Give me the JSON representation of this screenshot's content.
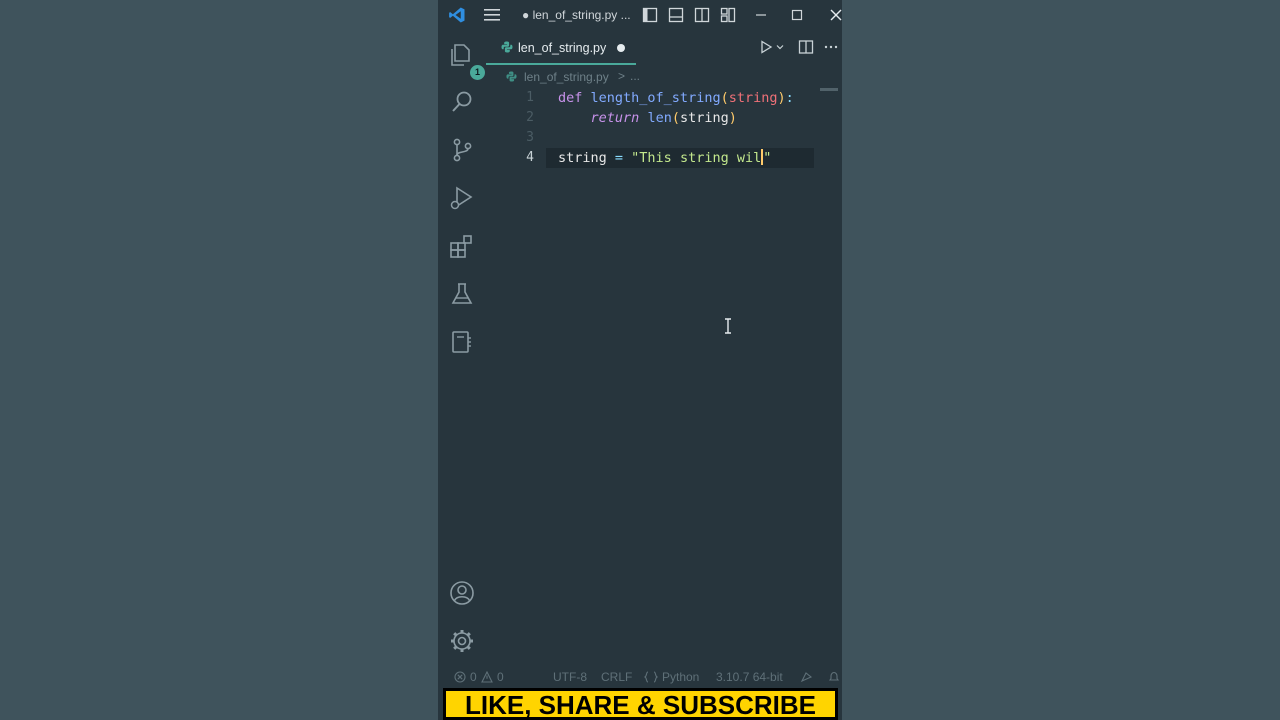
{
  "titlebar": {
    "title": "● len_of_string.py ..."
  },
  "activity": {
    "explorer_badge": "1"
  },
  "tab": {
    "label": "len_of_string.py"
  },
  "breadcrumb": {
    "file": "len_of_string.py",
    "separator": ">",
    "more": "..."
  },
  "editor": {
    "line_numbers": [
      "1",
      "2",
      "3",
      "4"
    ],
    "lines": [
      {
        "def": "def",
        "name": "length_of_string",
        "open": "(",
        "param": "string",
        "close": ")",
        "colon": ":"
      },
      {
        "indent": "    ",
        "ret": "return",
        "builtin": "len",
        "open": "(",
        "arg": "string",
        "close": ")"
      },
      {},
      {
        "var": "string",
        "assign": " = ",
        "text": "\"This string wil",
        "quote": "\""
      }
    ]
  },
  "statusbar": {
    "errors": "0",
    "warnings": "0",
    "encoding": "UTF-8",
    "eol": "CRLF",
    "language": "Python",
    "interpreter": "3.10.7 64-bit"
  },
  "banner": {
    "text": "LIKE, SHARE & SUBSCRIBE"
  },
  "colors": {
    "outer_background": "#3f535c",
    "editor_background": "#27353d",
    "accent": "#4aa99a",
    "banner": "#ffd400"
  },
  "icons": [
    "vscode-logo-icon",
    "menu-icon",
    "explorer-icon",
    "search-icon",
    "source-control-icon",
    "run-debug-icon",
    "extensions-icon",
    "testing-icon",
    "notebook-icon",
    "account-icon",
    "settings-gear-icon",
    "python-file-icon",
    "run-icon",
    "split-editor-icon",
    "more-icon"
  ]
}
